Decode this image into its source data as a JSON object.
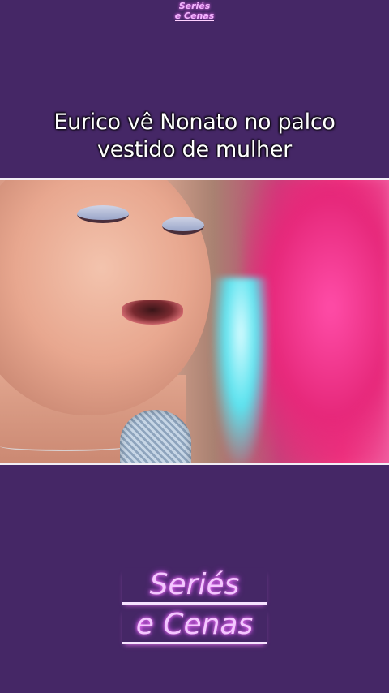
{
  "top_logo": {
    "line1": "Seriés",
    "line2": "e Cenas"
  },
  "caption": {
    "line1": "Eurico vê Nonato no palco",
    "line2": "vestido de mulher"
  },
  "bottom_logo": {
    "line1": "Seriés",
    "line2": "e Cenas"
  },
  "colors": {
    "background": "#452766",
    "logo": "#f4c7ff",
    "frame_border": "#f2eef5"
  }
}
